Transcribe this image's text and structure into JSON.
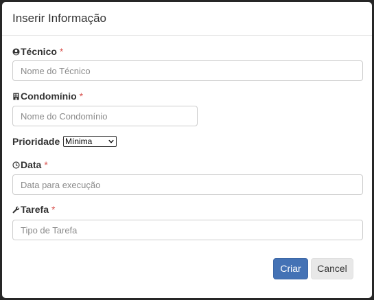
{
  "modal": {
    "title": "Inserir Informação"
  },
  "fields": {
    "tecnico": {
      "label": "Técnico",
      "required_mark": "*",
      "placeholder": "Nome do Técnico",
      "icon": "user-circle-icon"
    },
    "condominio": {
      "label": "Condomínio",
      "required_mark": "*",
      "placeholder": "Nome do Condomínio",
      "icon": "building-icon"
    },
    "prioridade": {
      "label": "Prioridade",
      "required_mark": "*",
      "selected": "Mínima"
    },
    "data": {
      "label": "Data",
      "required_mark": "*",
      "placeholder": "Data para execução",
      "icon": "clock-icon"
    },
    "tarefa": {
      "label": "Tarefa",
      "required_mark": "*",
      "placeholder": "Tipo de Tarefa",
      "icon": "wrench-icon"
    }
  },
  "buttons": {
    "create": "Criar",
    "cancel": "Cancel"
  },
  "colors": {
    "primary": "#4472b5",
    "required": "#d9534f"
  }
}
